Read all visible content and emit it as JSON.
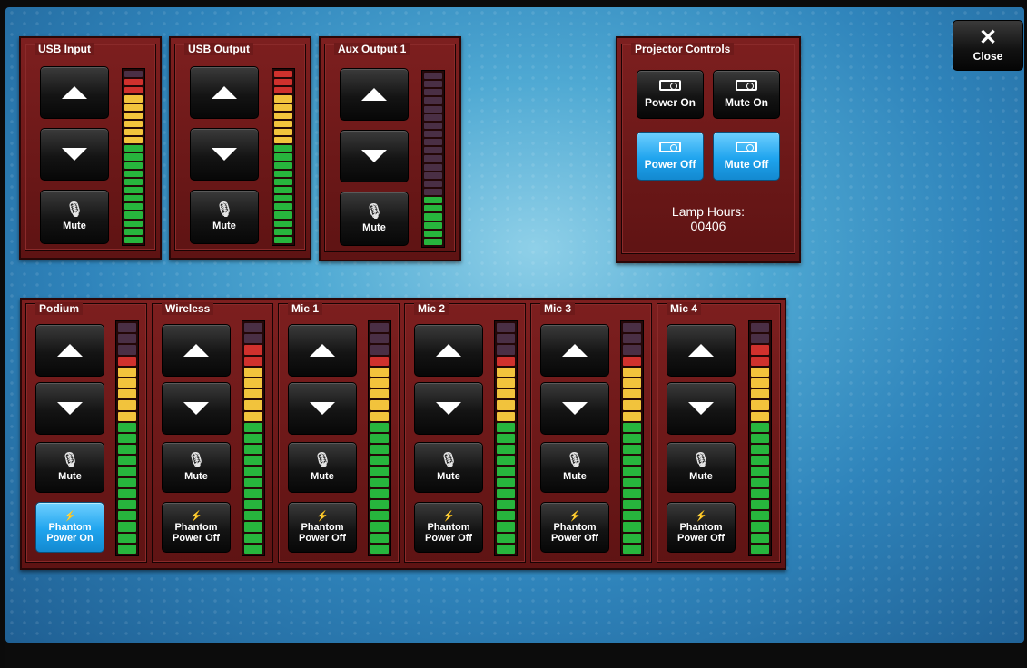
{
  "close": {
    "label": "Close"
  },
  "top_channels": [
    {
      "name": "USB Input",
      "mute_label": "Mute",
      "meter": [
        "off",
        "red",
        "red",
        "yellow",
        "yellow",
        "yellow",
        "yellow",
        "yellow",
        "yellow",
        "green",
        "green",
        "green",
        "green",
        "green",
        "green",
        "green",
        "green",
        "green",
        "green",
        "green",
        "green"
      ]
    },
    {
      "name": "USB Output",
      "mute_label": "Mute",
      "meter": [
        "red",
        "red",
        "red",
        "yellow",
        "yellow",
        "yellow",
        "yellow",
        "yellow",
        "yellow",
        "green",
        "green",
        "green",
        "green",
        "green",
        "green",
        "green",
        "green",
        "green",
        "green",
        "green",
        "green"
      ]
    },
    {
      "name": "Aux Output 1",
      "mute_label": "Mute",
      "meter": [
        "off",
        "off",
        "off",
        "off",
        "off",
        "off",
        "off",
        "off",
        "off",
        "off",
        "off",
        "off",
        "off",
        "off",
        "off",
        "green",
        "green",
        "green",
        "green",
        "green",
        "green"
      ]
    }
  ],
  "projector": {
    "title": "Projector Controls",
    "buttons": [
      {
        "label": "Power On",
        "active": false
      },
      {
        "label": "Mute On",
        "active": false
      },
      {
        "label": "Power Off",
        "active": true
      },
      {
        "label": "Mute Off",
        "active": true
      }
    ],
    "lamp_label": "Lamp Hours:",
    "lamp_value": "00406"
  },
  "mic_channels": [
    {
      "name": "Podium",
      "mute_label": "Mute",
      "phantom_label": "Phantom Power On",
      "phantom_active": true,
      "meter": [
        "off",
        "off",
        "off",
        "red",
        "yellow",
        "yellow",
        "yellow",
        "yellow",
        "yellow",
        "green",
        "green",
        "green",
        "green",
        "green",
        "green",
        "green",
        "green",
        "green",
        "green",
        "green",
        "green"
      ]
    },
    {
      "name": "Wireless",
      "mute_label": "Mute",
      "phantom_label": "Phantom Power Off",
      "phantom_active": false,
      "meter": [
        "off",
        "off",
        "red",
        "red",
        "yellow",
        "yellow",
        "yellow",
        "yellow",
        "yellow",
        "green",
        "green",
        "green",
        "green",
        "green",
        "green",
        "green",
        "green",
        "green",
        "green",
        "green",
        "green"
      ]
    },
    {
      "name": "Mic 1",
      "mute_label": "Mute",
      "phantom_label": "Phantom Power Off",
      "phantom_active": false,
      "meter": [
        "off",
        "off",
        "off",
        "red",
        "yellow",
        "yellow",
        "yellow",
        "yellow",
        "yellow",
        "green",
        "green",
        "green",
        "green",
        "green",
        "green",
        "green",
        "green",
        "green",
        "green",
        "green",
        "green"
      ]
    },
    {
      "name": "Mic 2",
      "mute_label": "Mute",
      "phantom_label": "Phantom Power Off",
      "phantom_active": false,
      "meter": [
        "off",
        "off",
        "off",
        "red",
        "yellow",
        "yellow",
        "yellow",
        "yellow",
        "yellow",
        "green",
        "green",
        "green",
        "green",
        "green",
        "green",
        "green",
        "green",
        "green",
        "green",
        "green",
        "green"
      ]
    },
    {
      "name": "Mic 3",
      "mute_label": "Mute",
      "phantom_label": "Phantom Power Off",
      "phantom_active": false,
      "meter": [
        "off",
        "off",
        "off",
        "red",
        "yellow",
        "yellow",
        "yellow",
        "yellow",
        "yellow",
        "green",
        "green",
        "green",
        "green",
        "green",
        "green",
        "green",
        "green",
        "green",
        "green",
        "green",
        "green"
      ]
    },
    {
      "name": "Mic 4",
      "mute_label": "Mute",
      "phantom_label": "Phantom Power Off",
      "phantom_active": false,
      "meter": [
        "off",
        "off",
        "red",
        "red",
        "yellow",
        "yellow",
        "yellow",
        "yellow",
        "yellow",
        "green",
        "green",
        "green",
        "green",
        "green",
        "green",
        "green",
        "green",
        "green",
        "green",
        "green",
        "green"
      ]
    }
  ],
  "meter_colors": {
    "red": "#d0312d",
    "yellow": "#f2c33c",
    "green": "#27b53d",
    "off": "#4a2f45"
  }
}
